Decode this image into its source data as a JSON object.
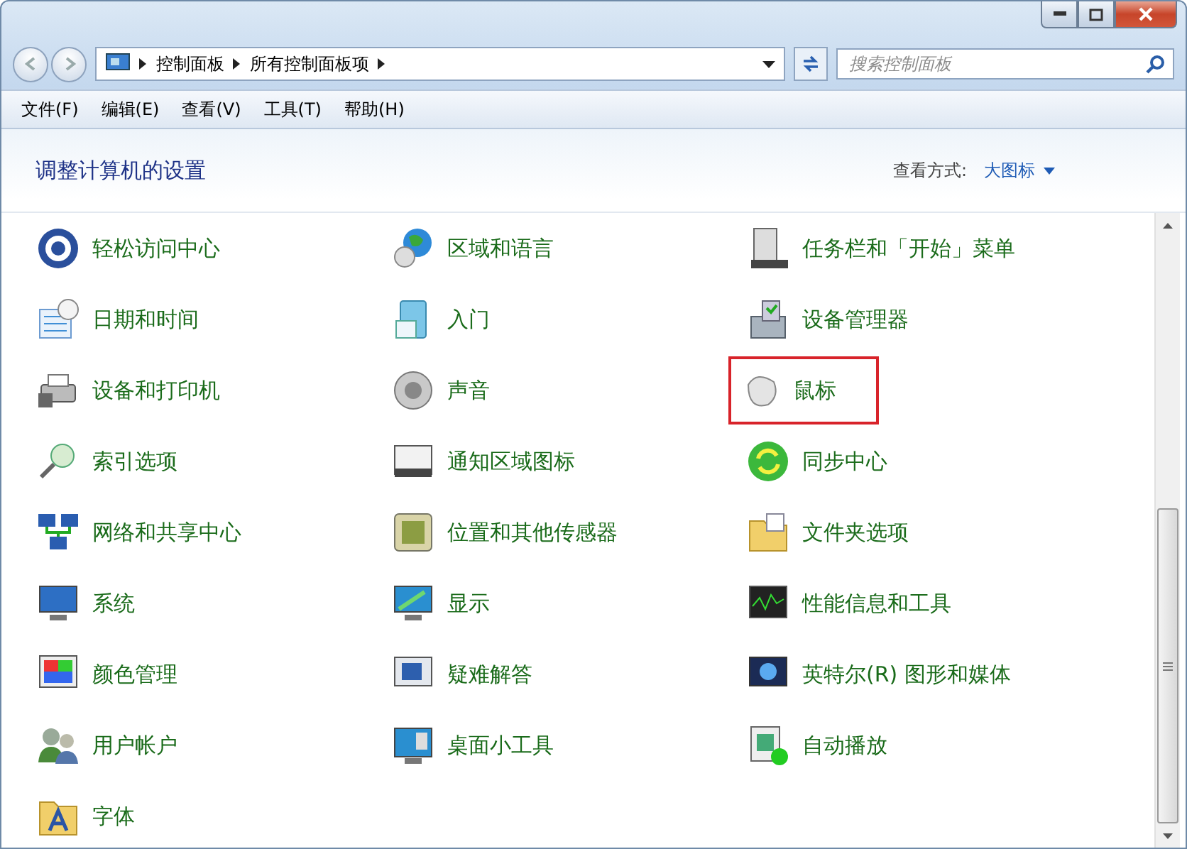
{
  "nav": {
    "breadcrumb": [
      "控制面板",
      "所有控制面板项"
    ],
    "search": {
      "placeholder": "搜索控制面板"
    }
  },
  "menu": [
    "文件(F)",
    "编辑(E)",
    "查看(V)",
    "工具(T)",
    "帮助(H)"
  ],
  "header": {
    "title": "调整计算机的设置",
    "view_label": "查看方式:",
    "view_value": "大图标"
  },
  "items": [
    {
      "label": "轻松访问中心",
      "highlighted": false
    },
    {
      "label": "区域和语言",
      "highlighted": false
    },
    {
      "label": "任务栏和「开始」菜单",
      "highlighted": false
    },
    {
      "label": "日期和时间",
      "highlighted": false
    },
    {
      "label": "入门",
      "highlighted": false
    },
    {
      "label": "设备管理器",
      "highlighted": false
    },
    {
      "label": "设备和打印机",
      "highlighted": false
    },
    {
      "label": "声音",
      "highlighted": false
    },
    {
      "label": "鼠标",
      "highlighted": true
    },
    {
      "label": "索引选项",
      "highlighted": false
    },
    {
      "label": "通知区域图标",
      "highlighted": false
    },
    {
      "label": "同步中心",
      "highlighted": false
    },
    {
      "label": "网络和共享中心",
      "highlighted": false
    },
    {
      "label": "位置和其他传感器",
      "highlighted": false
    },
    {
      "label": "文件夹选项",
      "highlighted": false
    },
    {
      "label": "系统",
      "highlighted": false
    },
    {
      "label": "显示",
      "highlighted": false
    },
    {
      "label": "性能信息和工具",
      "highlighted": false
    },
    {
      "label": "颜色管理",
      "highlighted": false
    },
    {
      "label": "疑难解答",
      "highlighted": false
    },
    {
      "label": "英特尔(R) 图形和媒体",
      "highlighted": false
    },
    {
      "label": "用户帐户",
      "highlighted": false
    },
    {
      "label": "桌面小工具",
      "highlighted": false
    },
    {
      "label": "自动播放",
      "highlighted": false
    },
    {
      "label": "字体",
      "highlighted": false
    }
  ]
}
